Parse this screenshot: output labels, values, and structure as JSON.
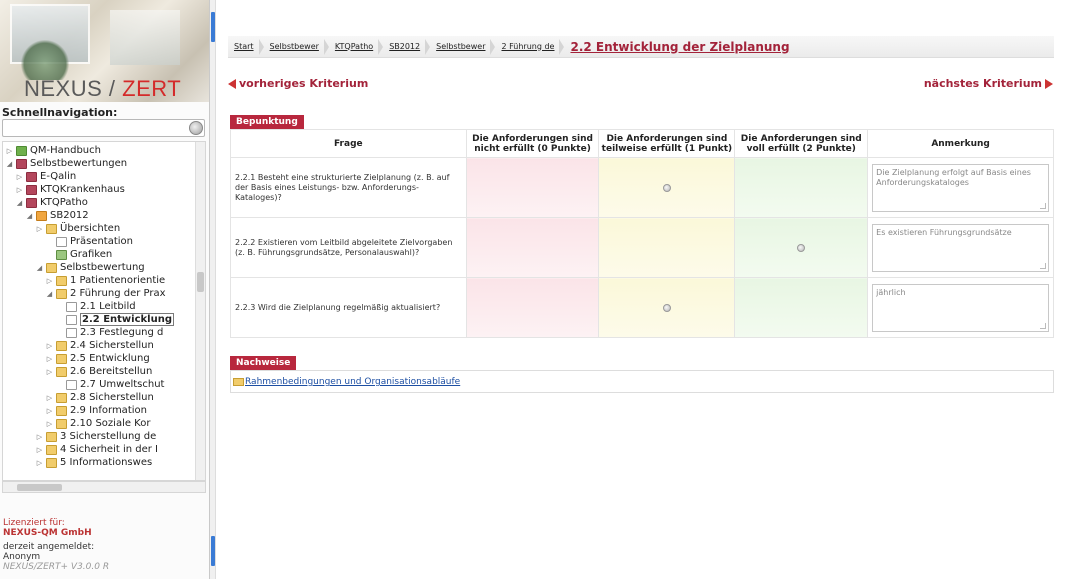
{
  "sidebar": {
    "logo": {
      "text_main": "NEXUS / ",
      "text_accent": "ZERT"
    },
    "quicknav_label": "Schnellnavigation:",
    "quicknav_placeholder": "",
    "tree": [
      {
        "label": "QM-Handbuch",
        "icon": "book-icon"
      },
      {
        "label": "Selbstbewertungen",
        "icon": "folder-icon"
      },
      {
        "label": "E-Qalin",
        "icon": "folder-icon"
      },
      {
        "label": "KTQKrankenhaus",
        "icon": "folder-icon"
      },
      {
        "label": "KTQPatho",
        "icon": "folder-icon"
      },
      {
        "label": "SB2012",
        "icon": "folder-icon"
      },
      {
        "label": "Übersichten",
        "icon": "folder-icon"
      },
      {
        "label": "Präsentation",
        "icon": "document-icon"
      },
      {
        "label": "Grafiken",
        "icon": "chart-icon"
      },
      {
        "label": "Selbstbewertung",
        "icon": "folder-icon"
      },
      {
        "label": "1 Patientenorientie",
        "icon": "folder-icon"
      },
      {
        "label": "2 Führung der Prax",
        "icon": "folder-icon"
      },
      {
        "label": "2.1 Leitbild",
        "icon": "document-icon"
      },
      {
        "label": "2.2 Entwicklung",
        "icon": "document-icon"
      },
      {
        "label": "2.3 Festlegung d",
        "icon": "document-icon"
      },
      {
        "label": "2.4 Sicherstellun",
        "icon": "folder-icon"
      },
      {
        "label": "2.5 Entwicklung",
        "icon": "folder-icon"
      },
      {
        "label": "2.6 Bereitstellun",
        "icon": "folder-icon"
      },
      {
        "label": "2.7 Umweltschut",
        "icon": "document-icon"
      },
      {
        "label": "2.8 Sicherstellun",
        "icon": "folder-icon"
      },
      {
        "label": "2.9 Information",
        "icon": "folder-icon"
      },
      {
        "label": "2.10 Soziale Kor",
        "icon": "folder-icon"
      },
      {
        "label": "3 Sicherstellung de",
        "icon": "folder-icon"
      },
      {
        "label": "4 Sicherheit in der I",
        "icon": "folder-icon"
      },
      {
        "label": "5 Informationswes",
        "icon": "folder-icon"
      }
    ],
    "license": {
      "label": "Lizenziert für:",
      "company": "NEXUS-QM GmbH",
      "login_label": "derzeit angemeldet:",
      "user": "Anonym",
      "version": "NEXUS/ZERT+ V3.0.0 R"
    }
  },
  "breadcrumb": {
    "items": [
      "Start",
      "Selbstbewer",
      "KTQPatho",
      "SB2012",
      "Selbstbewer",
      "2 Führung de"
    ],
    "current": "2.2 Entwicklung der Zielplanung"
  },
  "nav": {
    "prev": "vorheriges Kriterium",
    "next": "nächstes Kriterium"
  },
  "bepunktung": {
    "tab_label": "Bepunktung",
    "headers": {
      "frage": "Frage",
      "col0": "Die Anforderungen sind nicht erfüllt (0 Punkte)",
      "col1": "Die Anforderungen sind teilweise erfüllt (1 Punkt)",
      "col2": "Die Anforderungen sind voll erfüllt (2 Punkte)",
      "anmerkung": "Anmerkung"
    },
    "rows": [
      {
        "frage": "2.2.1 Besteht eine strukturierte Zielplanung (z. B. auf der Basis eines Leistungs- bzw. Anforderungs-Kataloges)?",
        "selected": 1,
        "anmerkung": "Die Zielplanung erfolgt auf Basis eines Anforderungskataloges"
      },
      {
        "frage": "2.2.2 Existieren vom Leitbild abgeleitete Zielvorgaben (z. B. Führungsgrundsätze, Personalauswahl)?",
        "selected": 2,
        "anmerkung": "Es existieren Führungsgrundsätze"
      },
      {
        "frage": "2.2.3 Wird die Zielplanung regelmäßig aktualisiert?",
        "selected": 1,
        "anmerkung": "jährlich"
      }
    ]
  },
  "nachweise": {
    "tab_label": "Nachweise",
    "link": "Rahmenbedingungen und Organisationsabläufe"
  }
}
